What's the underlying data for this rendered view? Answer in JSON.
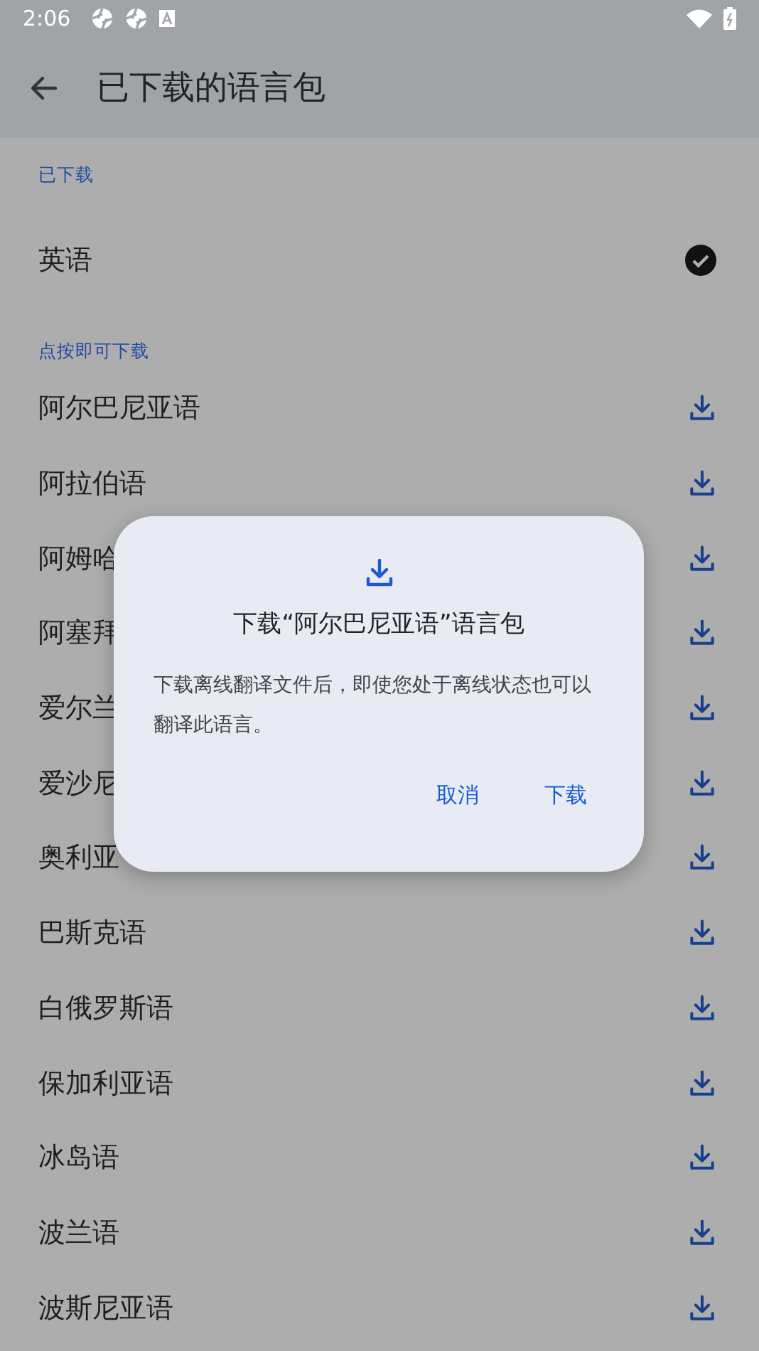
{
  "status_bar": {
    "time": "2:06"
  },
  "toolbar": {
    "title": "已下载的语言包"
  },
  "sections": [
    {
      "header": "已下载",
      "items": [
        {
          "name": "英语",
          "downloaded": true
        }
      ]
    },
    {
      "header": "点按即可下载",
      "items": [
        {
          "name": "阿尔巴尼亚语",
          "downloaded": false
        },
        {
          "name": "阿拉伯语",
          "downloaded": false
        },
        {
          "name": "阿姆哈",
          "downloaded": false
        },
        {
          "name": "阿塞拜",
          "downloaded": false
        },
        {
          "name": "爱尔兰",
          "downloaded": false
        },
        {
          "name": "爱沙尼",
          "downloaded": false
        },
        {
          "name": "奥利亚",
          "downloaded": false
        },
        {
          "name": "巴斯克语",
          "downloaded": false
        },
        {
          "name": "白俄罗斯语",
          "downloaded": false
        },
        {
          "name": "保加利亚语",
          "downloaded": false
        },
        {
          "name": "冰岛语",
          "downloaded": false
        },
        {
          "name": "波兰语",
          "downloaded": false
        },
        {
          "name": "波斯尼亚语",
          "downloaded": false
        }
      ]
    }
  ],
  "dialog": {
    "title": "下载“阿尔巴尼亚语”语言包",
    "message": "下载离线翻译文件后，即使您处于离线状态也可以翻译此语言。",
    "buttons": [
      "取消",
      "下载"
    ]
  }
}
